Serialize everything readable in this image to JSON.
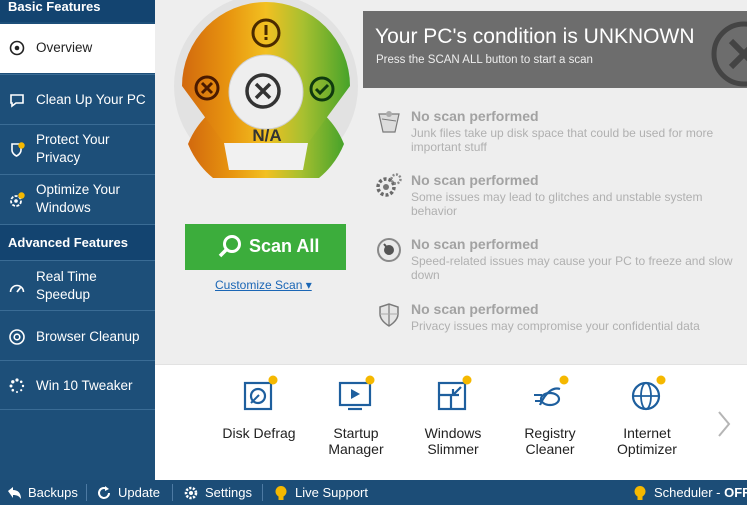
{
  "sidebar": {
    "basic_header": "Basic Features",
    "advanced_header": "Advanced Features",
    "items": [
      {
        "label": "Overview"
      },
      {
        "label": "Clean Up Your PC"
      },
      {
        "label": "Protect Your Privacy"
      },
      {
        "label": "Optimize Your Windows"
      },
      {
        "label": "Real Time Speedup"
      },
      {
        "label": "Browser Cleanup"
      },
      {
        "label": "Win 10 Tweaker"
      }
    ]
  },
  "gauge": {
    "value_label": "N/A",
    "colors": {
      "left": "#d2690e",
      "top": "#f2c021",
      "right": "#47a32a",
      "center": "#eeeeee"
    }
  },
  "banner": {
    "title": "Your PC's condition is UNKNOWN",
    "subtitle": "Press the SCAN ALL button to start a scan"
  },
  "scan": {
    "button_label": "Scan All",
    "customize_label": "Customize Scan ▾"
  },
  "status": [
    {
      "icon": "broom-icon",
      "title": "No scan performed",
      "desc": "Junk files take up disk space that could be used for more important stuff"
    },
    {
      "icon": "gears-icon",
      "title": "No scan performed",
      "desc": "Some issues may lead to glitches and unstable system behavior"
    },
    {
      "icon": "speedometer-icon",
      "title": "No scan performed",
      "desc": "Speed-related issues may cause your PC to freeze and slow down"
    },
    {
      "icon": "shield-icon",
      "title": "No scan performed",
      "desc": "Privacy issues may compromise your confidential data"
    }
  ],
  "tools": [
    {
      "label": "Disk Defrag",
      "icon": "disk-defrag-icon"
    },
    {
      "label": "Startup Manager",
      "icon": "startup-manager-icon"
    },
    {
      "label": "Windows Slimmer",
      "icon": "windows-slimmer-icon"
    },
    {
      "label": "Registry Cleaner",
      "icon": "registry-cleaner-icon"
    },
    {
      "label": "Internet Optimizer",
      "icon": "internet-optimizer-icon"
    }
  ],
  "bottom_bar": {
    "backups": "Backups",
    "update": "Update",
    "settings": "Settings",
    "live_support": "Live Support",
    "scheduler": "Scheduler",
    "scheduler_state": "OFF"
  },
  "colors": {
    "sidebar": "#1d4f79",
    "accent_green": "#3cad3c",
    "link_blue": "#1a66b5",
    "icon_blue": "#1e5f9e",
    "badge_yellow": "#f5b800"
  }
}
